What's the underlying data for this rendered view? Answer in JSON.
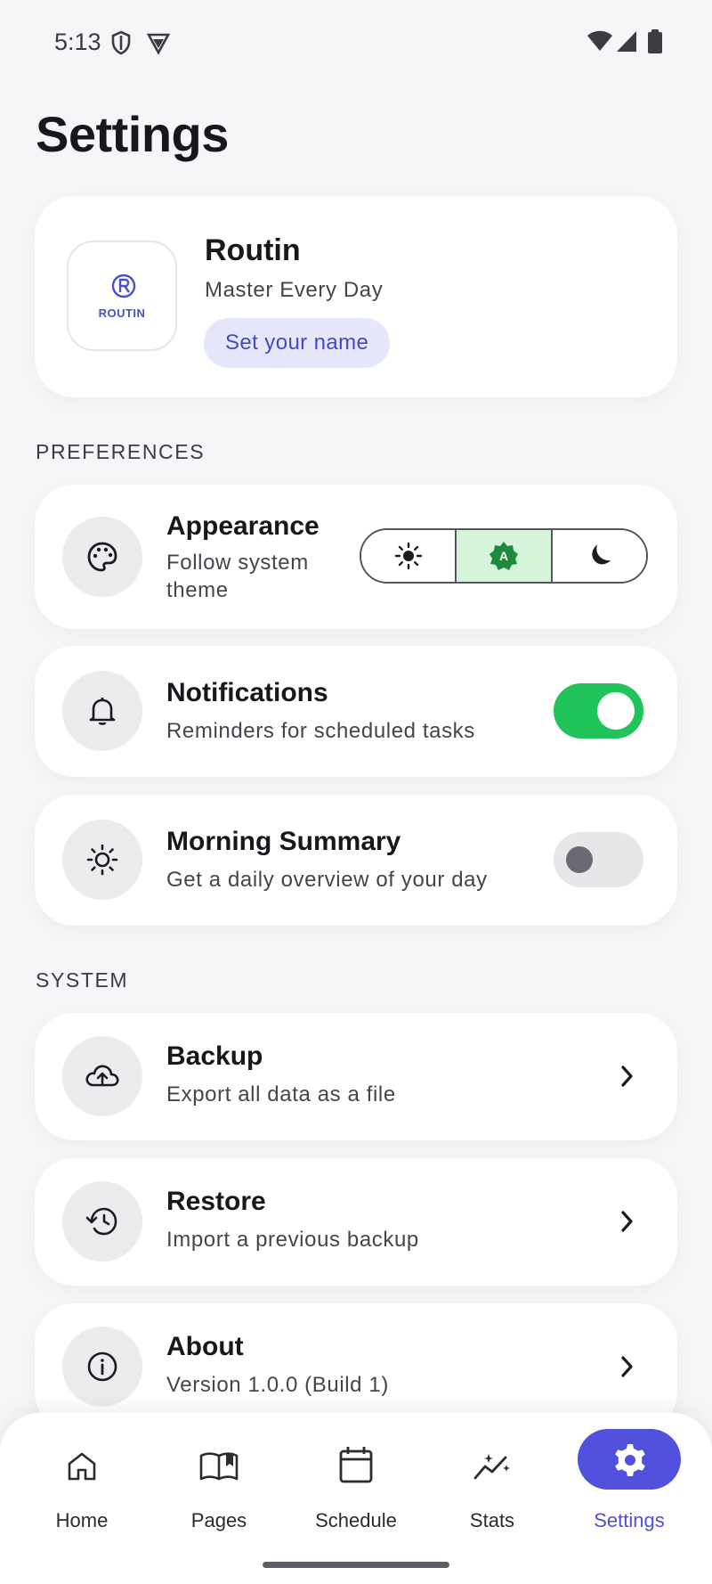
{
  "status_bar": {
    "time": "5:13"
  },
  "header": {
    "title": "Settings"
  },
  "profile": {
    "logo_text": "ROUTIN",
    "app_name": "Routin",
    "tagline": "Master Every Day",
    "name_button": "Set your name"
  },
  "preferences": {
    "section_label": "PREFERENCES",
    "appearance": {
      "title": "Appearance",
      "subtitle": "Follow system theme",
      "options": [
        "light",
        "auto",
        "dark"
      ],
      "selected": "auto",
      "auto_badge": "A"
    },
    "notifications": {
      "title": "Notifications",
      "subtitle": "Reminders for scheduled tasks",
      "enabled": true
    },
    "morning_summary": {
      "title": "Morning Summary",
      "subtitle": "Get a daily overview of your day",
      "enabled": false
    }
  },
  "system": {
    "section_label": "SYSTEM",
    "items": [
      {
        "title": "Backup",
        "subtitle": "Export all data as a file",
        "icon": "cloud-upload-icon"
      },
      {
        "title": "Restore",
        "subtitle": "Import a previous backup",
        "icon": "history-icon"
      },
      {
        "title": "About",
        "subtitle": "Version 1.0.0 (Build 1)",
        "icon": "info-icon"
      }
    ]
  },
  "nav": {
    "items": [
      {
        "label": "Home",
        "icon": "home-icon"
      },
      {
        "label": "Pages",
        "icon": "book-icon"
      },
      {
        "label": "Schedule",
        "icon": "calendar-icon"
      },
      {
        "label": "Stats",
        "icon": "stats-icon"
      },
      {
        "label": "Settings",
        "icon": "gear-icon"
      }
    ],
    "active": "Settings"
  },
  "colors": {
    "accent": "#5251de",
    "toggle_on": "#21c45a",
    "auto_selected_bg": "#d6f4da",
    "auto_badge": "#1f8a3c"
  }
}
